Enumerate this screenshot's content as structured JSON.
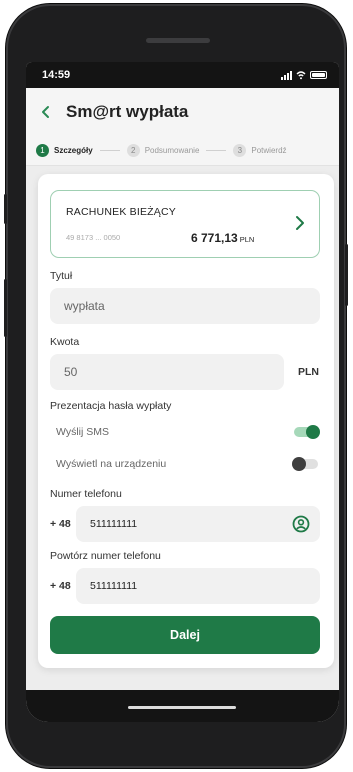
{
  "status_bar": {
    "time": "14:59"
  },
  "header": {
    "title": "Sm@rt wypłata"
  },
  "stepper": {
    "steps": [
      {
        "number": "1",
        "label": "Szczegóły"
      },
      {
        "number": "2",
        "label": "Podsumowanie"
      },
      {
        "number": "3",
        "label": "Potwierdź"
      }
    ]
  },
  "account": {
    "name": "RACHUNEK BIEŻĄCY",
    "number": "49 8173 ... 0050",
    "balance": "6 771,13",
    "currency": "PLN"
  },
  "form": {
    "title_label": "Tytuł",
    "title_value": "wypłata",
    "amount_label": "Kwota",
    "amount_value": "50",
    "amount_currency": "PLN",
    "password_section_label": "Prezentacja hasła wypłaty",
    "option_sms": {
      "label": "Wyślij SMS",
      "enabled": true
    },
    "option_device": {
      "label": "Wyświetl na urządzeniu",
      "enabled": false
    },
    "phone_label": "Numer telefonu",
    "phone_prefix": "+ 48",
    "phone_value": "511111111",
    "phone_repeat_label": "Powtórz numer telefonu",
    "phone_repeat_prefix": "+ 48",
    "phone_repeat_value": "511111111"
  },
  "actions": {
    "next_label": "Dalej"
  },
  "colors": {
    "accent": "#1f7a47",
    "accent_light": "#a6d8b9",
    "tile_border": "#9fcfb2"
  }
}
